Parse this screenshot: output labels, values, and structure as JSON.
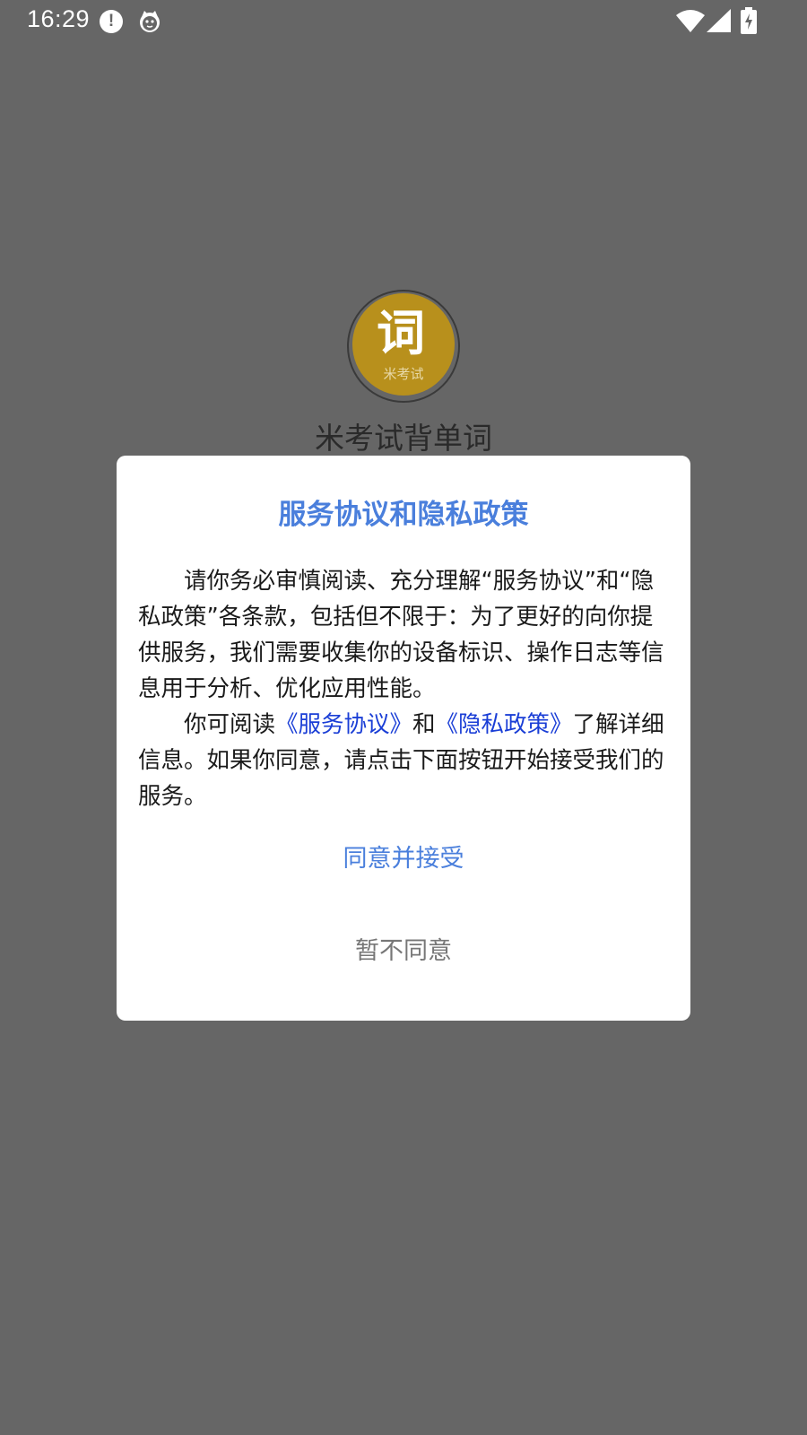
{
  "status_bar": {
    "time": "16:29",
    "alert_glyph": "!",
    "icons": [
      "alert-icon",
      "cat-icon",
      "wifi-icon",
      "signal-icon",
      "battery-charging-icon"
    ]
  },
  "splash": {
    "logo_char": "词",
    "logo_subtext": "米考试",
    "app_name": "米考试背单词"
  },
  "dialog": {
    "title": "服务协议和隐私政策",
    "paragraph1": "请你务必审慎阅读、充分理解“服务协议”和“隐私政策”各条款，包括但不限于：为了更好的向你提供服务，我们需要收集你的设备标识、操作日志等信息用于分析、优化应用性能。",
    "paragraph2_prefix": "你可阅读",
    "service_link": "《服务协议》",
    "paragraph2_and": "和",
    "privacy_link": "《隐私政策》",
    "paragraph2_suffix": "了解详细信息。如果你同意，请点击下面按钮开始接受我们的服务。",
    "agree_label": "同意并接受",
    "decline_label": "暂不同意"
  },
  "colors": {
    "overlay": "#666666",
    "accent": "#4a7fdc",
    "link": "#1a3ed6",
    "decline": "#777777",
    "logo_gold": "#b8901c"
  }
}
